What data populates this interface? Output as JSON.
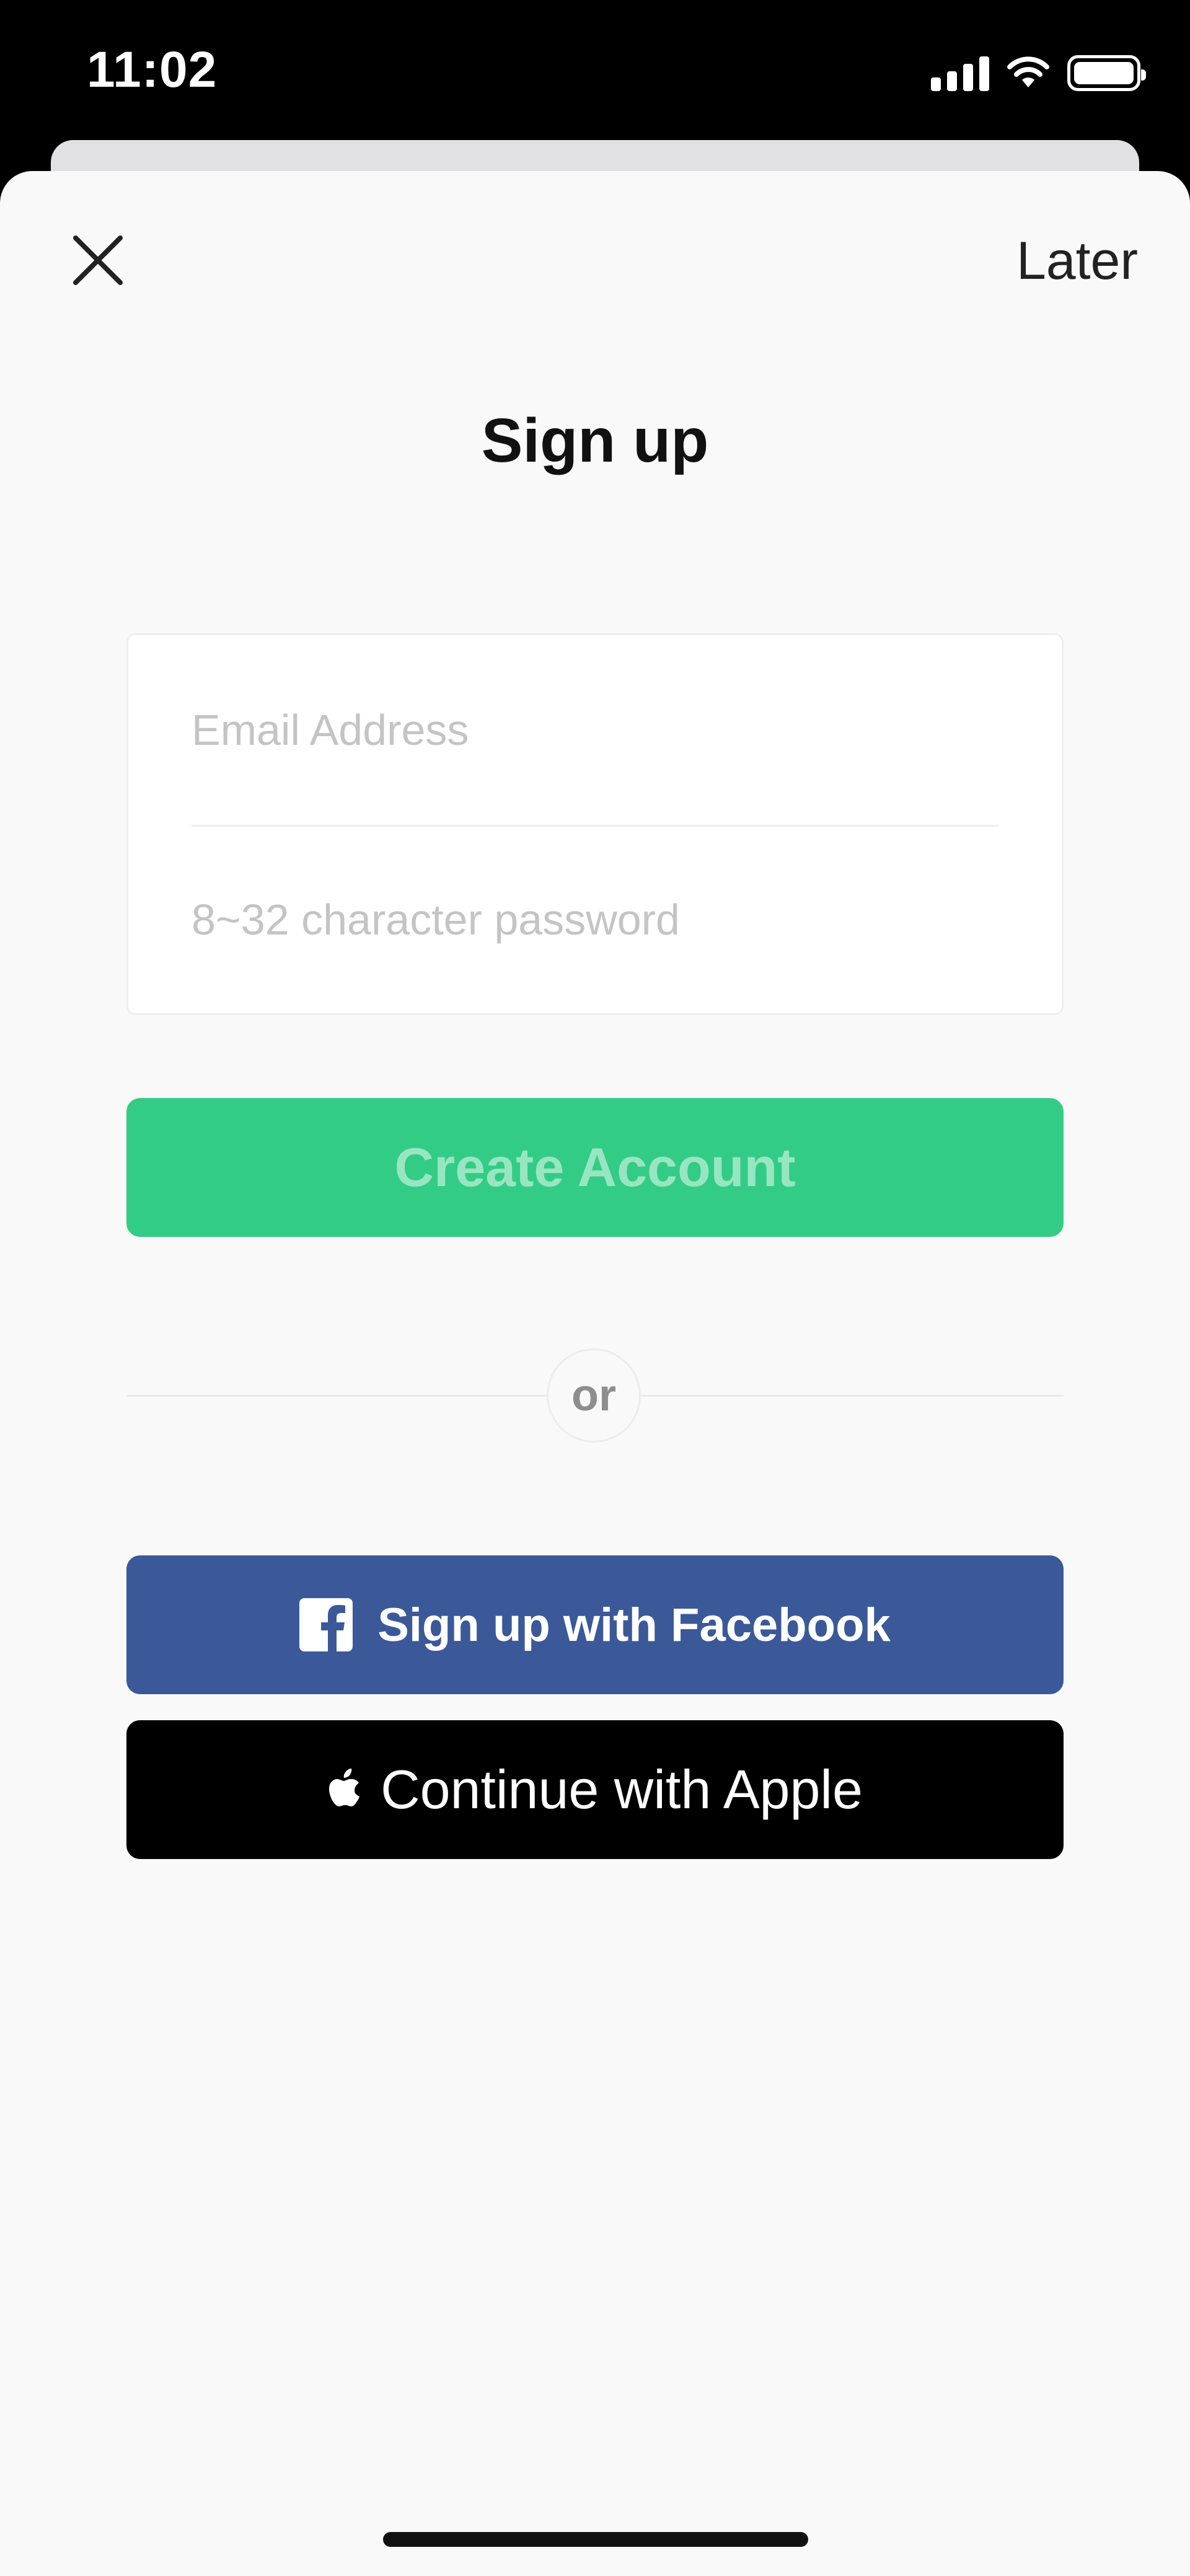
{
  "status_bar": {
    "time": "11:02",
    "icons": [
      "signal-icon",
      "wifi-icon",
      "battery-icon"
    ]
  },
  "header": {
    "close_icon": "close-icon",
    "later_label": "Later"
  },
  "title": "Sign up",
  "form": {
    "email_placeholder": "Email Address",
    "password_placeholder": "8~32 character password"
  },
  "create_account_label": "Create Account",
  "divider_label": "or",
  "social": {
    "facebook_label": "Sign up with Facebook",
    "facebook_icon": "facebook-icon",
    "apple_label": "Continue with Apple",
    "apple_icon": "apple-icon"
  },
  "colors": {
    "sheet_background": "#f9f9f9",
    "create_account": "#32cc86",
    "create_account_text": "#98e6c1",
    "facebook": "#3b5998",
    "apple": "#000000"
  }
}
